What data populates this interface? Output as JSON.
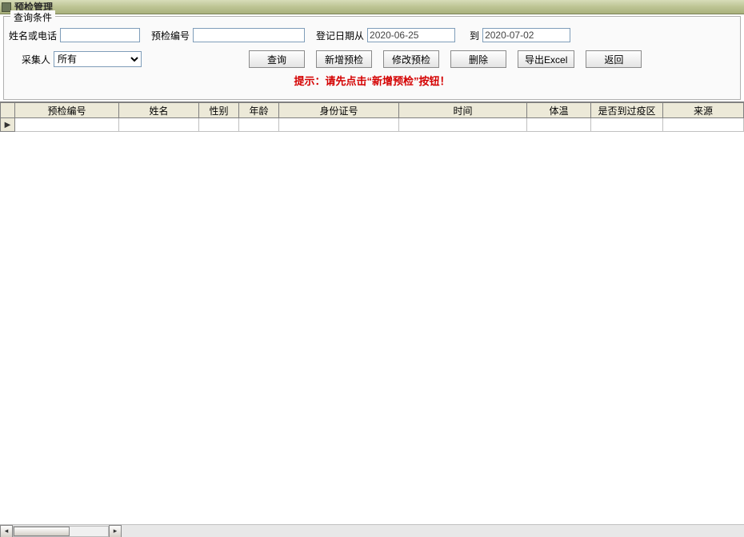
{
  "window": {
    "title": "预检管理"
  },
  "groupbox": {
    "label": "查询条件"
  },
  "fields": {
    "name_phone_label": "姓名或电话",
    "name_phone_value": "",
    "pre_id_label": "预检编号",
    "pre_id_value": "",
    "date_from_label": "登记日期从",
    "date_from_value": "2020-06-25",
    "date_to_label": "到",
    "date_to_value": "2020-07-02",
    "collector_label": "采集人",
    "collector_value": "所有",
    "collector_options": [
      "所有"
    ]
  },
  "buttons": {
    "query": "查询",
    "add": "新增预检",
    "edit": "修改预检",
    "delete": "删除",
    "export": "导出Excel",
    "back": "返回"
  },
  "hint": "提示：请先点击“新增预检”按钮！",
  "grid": {
    "columns": [
      "预检编号",
      "姓名",
      "性别",
      "年龄",
      "身份证号",
      "时间",
      "体温",
      "是否到过疫区",
      "来源"
    ],
    "rows": []
  }
}
